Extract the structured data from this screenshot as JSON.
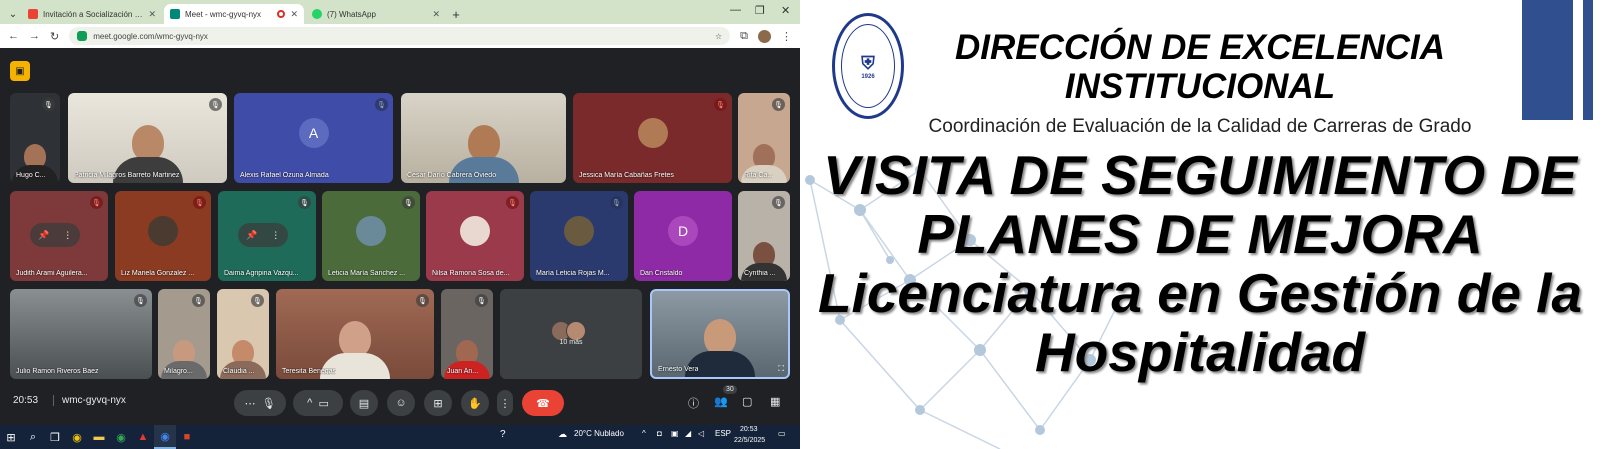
{
  "browser": {
    "tabs": [
      {
        "label": "Invitación a Socialización de Av",
        "favicon": "gmail-icon",
        "active": false
      },
      {
        "label": "Meet - wmc-gyvq-nyx",
        "favicon": "meet-icon",
        "active": true,
        "recording": true
      },
      {
        "label": "(7) WhatsApp",
        "favicon": "whatsapp-icon",
        "active": false
      }
    ],
    "url": "meet.google.com/wmc-gyvq-nyx"
  },
  "meet": {
    "participants_row1": [
      "Hugo C...",
      "Patricia Milagros Barreto Martinez",
      "Alexis Rafael Ozuna Almada",
      "Cesar Darío Cabrera Oviedo",
      "Jessica María Cabañas Fretes",
      "Rita Ca..."
    ],
    "participants_row2": [
      "Judith Arami Aguilera...",
      "Liz Mariela Gonzalez ...",
      "Daima Agripina Vazqu...",
      "Leticia María Sanchez ...",
      "Nilsa Ramona Sosa de...",
      "María Leticia Rojas M...",
      "Dan Cristaldo",
      "Cynthia ..."
    ],
    "participants_row3": [
      "Julio Ramon Riveros Baez",
      "Milagro...",
      "Claudia ...",
      "Teresita Benegas",
      "Juan An...",
      "Ernesto Vera"
    ],
    "avatar_letters": {
      "alexis": "A",
      "dan": "D"
    },
    "more_label": "10 más",
    "clock": "20:53",
    "meeting_code": "wmc-gyvq-nyx",
    "people_count": "30",
    "accent_end": "#ea4335"
  },
  "taskbar": {
    "weather": "20°C  Nublado",
    "lang": "ESP",
    "time": "20:53",
    "date": "22/5/2025"
  },
  "slide": {
    "title_line1": "DIRECCIÓN DE EXCELENCIA",
    "title_line2": "INSTITUCIONAL",
    "subtitle": "Coordinación de Evaluación de la Calidad de Carreras de Grado",
    "big_line1": "VISITA DE SEGUIMIENTO DE",
    "big_line2": "PLANES DE MEJORA",
    "big_line3": "Licenciatura en Gestión de la",
    "big_line4": "Hospitalidad",
    "seal_year": "1926",
    "accent": "#2f4f8f"
  }
}
